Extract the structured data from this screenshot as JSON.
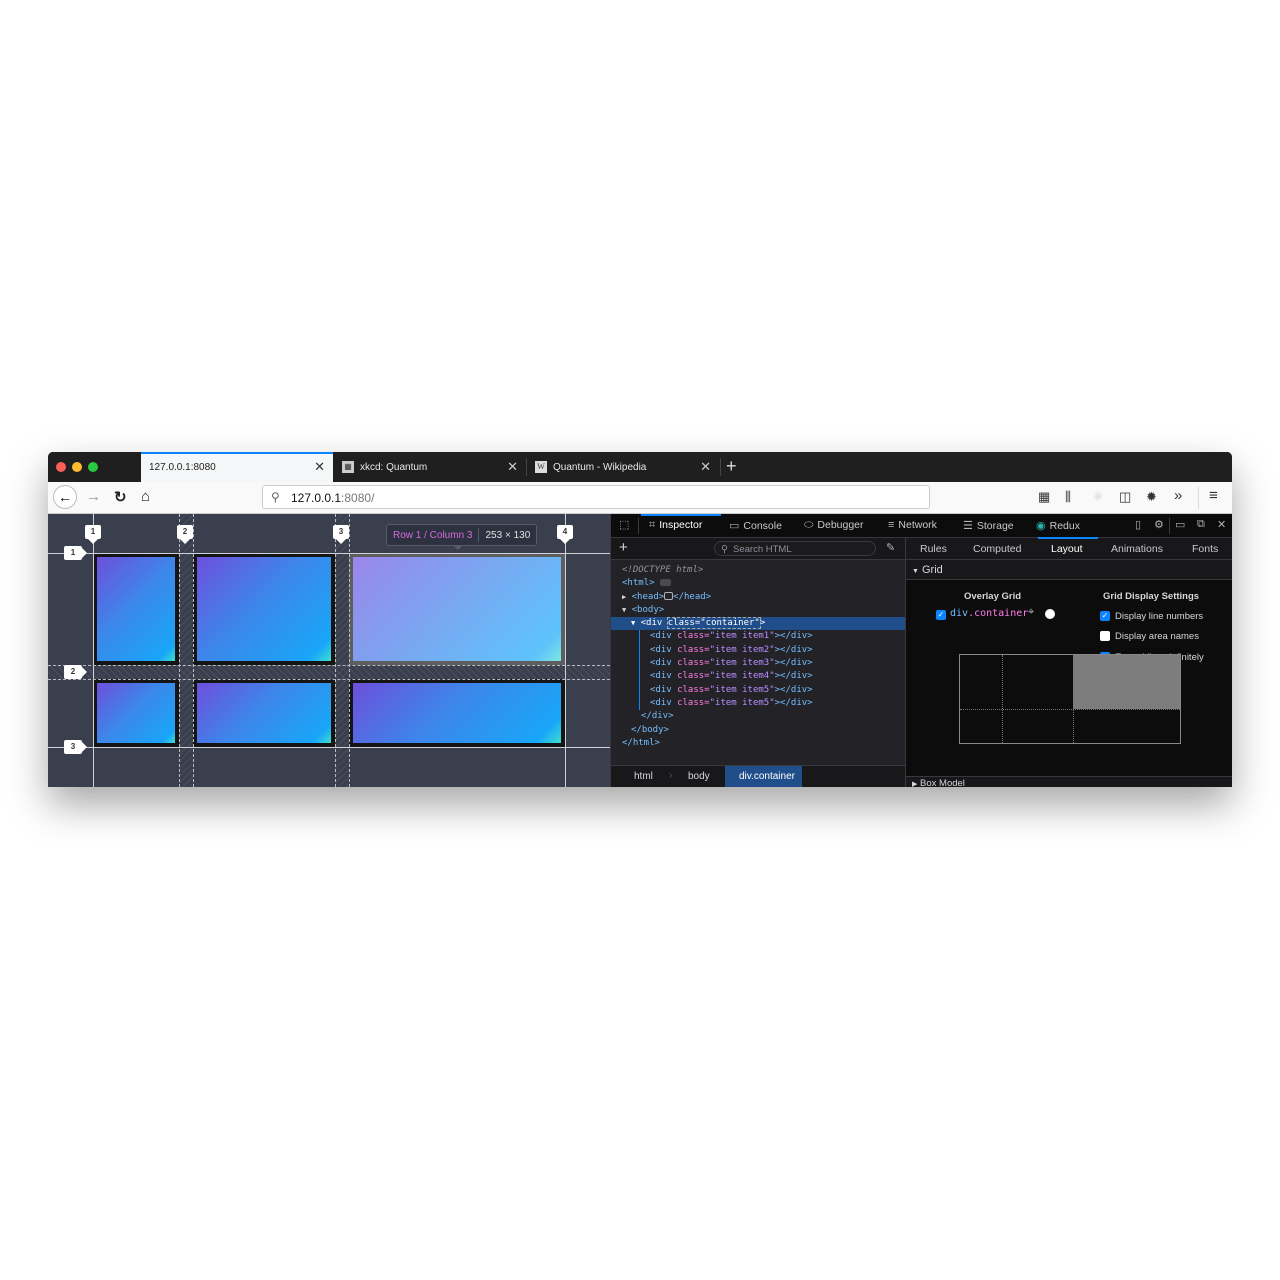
{
  "browser": {
    "tabs": [
      {
        "title": "127.0.0.1:8080",
        "active": true,
        "favicon": null
      },
      {
        "title": "xkcd: Quantum",
        "active": false,
        "favicon": "xkcd-favicon"
      },
      {
        "title": "Quantum - Wikipedia",
        "active": false,
        "favicon": "W"
      }
    ],
    "close_glyph": "✕",
    "new_tab_glyph": "+",
    "url_host": "127.0.0.1",
    "url_rest": ":8080/",
    "nav": {
      "back": "←",
      "forward": "→",
      "reload": "↻",
      "home": "⌂"
    },
    "toolbar_icons": [
      "extensions-icon",
      "library-icon",
      "react-devtools-icon",
      "sidebar-icon",
      "bug-icon",
      "overflow-icon",
      "menu-icon"
    ]
  },
  "page": {
    "col_line_numbers": [
      "1",
      "2",
      "3",
      "4"
    ],
    "row_line_numbers": [
      "1",
      "2",
      "3"
    ],
    "grid_items": [
      "item1",
      "item2",
      "item3",
      "item4",
      "item5",
      "item5"
    ],
    "highlighted_cell": {
      "row_col": "Row 1 / Column 3",
      "size": "253 × 130"
    }
  },
  "devtools": {
    "tabs": [
      {
        "label": "Inspector",
        "icon": "⌗",
        "active": true
      },
      {
        "label": "Console",
        "icon": "▭",
        "active": false
      },
      {
        "label": "Debugger",
        "icon": "⬭",
        "active": false
      },
      {
        "label": "Network",
        "icon": "≡",
        "active": false
      },
      {
        "label": "Storage",
        "icon": "☰",
        "active": false
      },
      {
        "label": "Redux",
        "icon": "◉",
        "active": false
      }
    ],
    "search_placeholder": "Search HTML",
    "markup": {
      "doctype": "<!DOCTYPE html>",
      "html_open": "<html>",
      "head": "<head>",
      "head_close": "</head>",
      "body_open": "<body>",
      "container_open_tag": "<div ",
      "container_attr": "class=",
      "container_value": "\"container\"",
      "container_close": ">",
      "children": [
        {
          "attr": "class=",
          "value": "\"item item1\""
        },
        {
          "attr": "class=",
          "value": "\"item item2\""
        },
        {
          "attr": "class=",
          "value": "\"item item3\""
        },
        {
          "attr": "class=",
          "value": "\"item item4\""
        },
        {
          "attr": "class=",
          "value": "\"item item5\""
        },
        {
          "attr": "class=",
          "value": "\"item item5\""
        }
      ],
      "div_open": "<div ",
      "div_end": "></div>",
      "div_close": "</div>",
      "body_close": "</body>",
      "html_close": "</html>"
    },
    "breadcrumbs": [
      "html",
      "body",
      "div.container"
    ],
    "sidebar_tabs": [
      {
        "label": "Rules",
        "active": false
      },
      {
        "label": "Computed",
        "active": false
      },
      {
        "label": "Layout",
        "active": true
      },
      {
        "label": "Animations",
        "active": false
      },
      {
        "label": "Fonts",
        "active": false
      }
    ],
    "grid_section": "Grid",
    "overlay_grid_title": "Overlay Grid",
    "overlay_grid_item": {
      "tag": "div",
      "cls": ".container",
      "checked": true
    },
    "settings_title": "Grid Display Settings",
    "settings": [
      {
        "label": "Display line numbers",
        "checked": true
      },
      {
        "label": "Display area names",
        "checked": false
      },
      {
        "label": "Extend lines infinitely",
        "checked": true
      }
    ],
    "box_model_label": "Box Model"
  }
}
